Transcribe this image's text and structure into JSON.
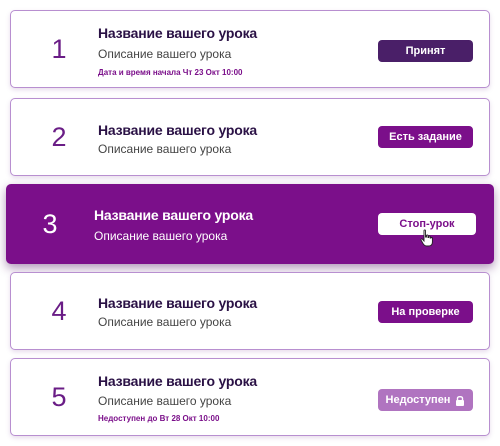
{
  "lessons": [
    {
      "number": "1",
      "title": "Название вашего урока",
      "description": "Описание вашего урока",
      "meta": "Дата и время начала Чт 23 Окт 10:00",
      "button": "Принят",
      "status": "accepted"
    },
    {
      "number": "2",
      "title": "Название вашего урока",
      "description": "Описание вашего урока",
      "button": "Есть задание",
      "status": "has-task"
    },
    {
      "number": "3",
      "title": "Название вашего урока",
      "description": "Описание вашего урока",
      "button": "Стоп-урок",
      "status": "active"
    },
    {
      "number": "4",
      "title": "Название вашего урока",
      "description": "Описание вашего урока",
      "button": "На проверке",
      "status": "review"
    },
    {
      "number": "5",
      "title": "Название вашего урока",
      "description": "Описание вашего урока",
      "meta": "Недоступен до Вт 28 Окт 10:00",
      "button": "Недоступен",
      "button_icon": "lock-icon",
      "status": "unavailable"
    }
  ],
  "colors": {
    "primary": "#7b0f8a",
    "dark_button": "#4a1f68",
    "disabled_button": "#b074c0",
    "card_border": "#b88fd0",
    "title_text": "#2a1145"
  }
}
